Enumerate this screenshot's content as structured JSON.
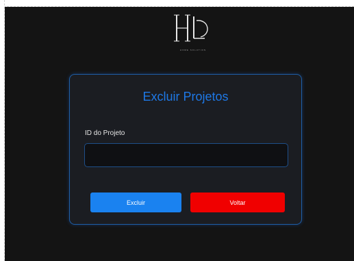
{
  "logo": {
    "monogram": "HL",
    "tagline": "HOME SOLUTION",
    "icon": "hl-monogram-logo"
  },
  "form": {
    "title": "Excluir Projetos",
    "field_label": "ID do Projeto",
    "field_value": "",
    "field_placeholder": "",
    "delete_label": "Excluir",
    "back_label": "Voltar"
  },
  "colors": {
    "background": "#141414",
    "card": "#1b1d22",
    "card_border": "#1e5fa8",
    "title": "#1e78e6",
    "primary_button": "#1a82f0",
    "danger_button": "#f00000"
  }
}
